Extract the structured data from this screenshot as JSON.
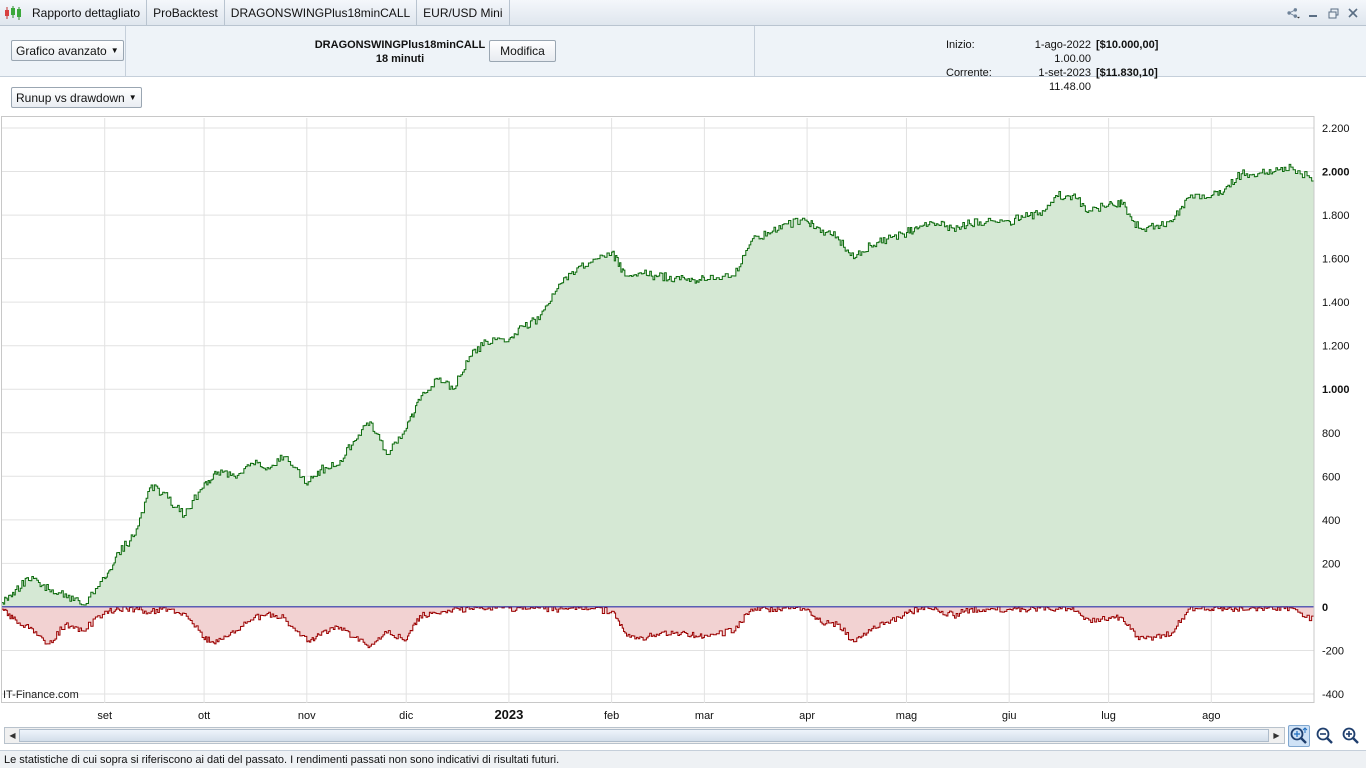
{
  "tabs": [
    "Rapporto dettagliato",
    "ProBacktest",
    "DRAGONSWINGPlus18minCALL",
    "EUR/USD Mini"
  ],
  "header": {
    "chart_mode": "Grafico avanzato",
    "strategy_name": "DRAGONSWINGPlus18minCALL",
    "timeframe": "18 minuti",
    "edit_button": "Modifica",
    "start_label": "Inizio:",
    "start_date": "1-ago-2022 1.00.00",
    "start_amount": "[$10.000,00]",
    "current_label": "Corrente:",
    "current_date": "1-set-2023 11.48.00",
    "current_amount": "[$11.830,10]"
  },
  "chart_selector": "Runup vs drawdown",
  "brand": "IT-Finance.com",
  "status_text": "Le statistiche di cui sopra si riferiscono ai dati del passato. I rendimenti passati non sono indicativi di risultati futuri.",
  "colors": {
    "runup_line": "#0b6a0b",
    "runup_fill": "#d5e8d4",
    "drawdown_line": "#9b0000",
    "drawdown_fill": "#f2d2d2",
    "zero_line": "#2a2aa8"
  },
  "chart_data": {
    "type": "area",
    "ylim": [
      -400,
      2200
    ],
    "y_ticks": [
      "2.200",
      "2.000",
      "1.800",
      "1.600",
      "1.400",
      "1.200",
      "1.000",
      "800",
      "600",
      "400",
      "200",
      "0",
      "-200",
      "-400"
    ],
    "y_tick_values": [
      2200,
      2000,
      1800,
      1600,
      1400,
      1200,
      1000,
      800,
      600,
      400,
      200,
      0,
      -200,
      -400
    ],
    "x_ticks": [
      "set",
      "ott",
      "nov",
      "dic",
      "2023",
      "feb",
      "mar",
      "apr",
      "mag",
      "giu",
      "lug",
      "ago"
    ],
    "x_tick_dates": [
      "2022-09-01",
      "2022-10-01",
      "2022-11-01",
      "2022-12-01",
      "2023-01-01",
      "2023-02-01",
      "2023-03-01",
      "2023-04-01",
      "2023-05-01",
      "2023-06-01",
      "2023-07-01",
      "2023-08-01"
    ],
    "series": [
      {
        "name": "Runup",
        "x": [
          "2022-08-01",
          "2022-08-05",
          "2022-08-10",
          "2022-08-15",
          "2022-08-20",
          "2022-08-25",
          "2022-09-01",
          "2022-09-05",
          "2022-09-10",
          "2022-09-15",
          "2022-09-20",
          "2022-09-25",
          "2022-10-01",
          "2022-10-05",
          "2022-10-10",
          "2022-10-15",
          "2022-10-20",
          "2022-10-25",
          "2022-11-01",
          "2022-11-05",
          "2022-11-10",
          "2022-11-15",
          "2022-11-20",
          "2022-11-25",
          "2022-12-01",
          "2022-12-05",
          "2022-12-10",
          "2022-12-15",
          "2022-12-20",
          "2022-12-25",
          "2023-01-01",
          "2023-01-05",
          "2023-01-10",
          "2023-01-15",
          "2023-01-20",
          "2023-01-25",
          "2023-02-01",
          "2023-02-05",
          "2023-02-10",
          "2023-02-15",
          "2023-02-20",
          "2023-02-25",
          "2023-03-01",
          "2023-03-10",
          "2023-03-15",
          "2023-03-20",
          "2023-03-25",
          "2023-04-01",
          "2023-04-05",
          "2023-04-10",
          "2023-04-15",
          "2023-04-20",
          "2023-04-25",
          "2023-05-01",
          "2023-05-05",
          "2023-05-10",
          "2023-05-15",
          "2023-05-20",
          "2023-05-25",
          "2023-06-01",
          "2023-06-05",
          "2023-06-10",
          "2023-06-15",
          "2023-06-20",
          "2023-06-25",
          "2023-07-01",
          "2023-07-05",
          "2023-07-10",
          "2023-07-15",
          "2023-07-20",
          "2023-07-25",
          "2023-08-01",
          "2023-08-05",
          "2023-08-10",
          "2023-08-15",
          "2023-08-20",
          "2023-08-25",
          "2023-09-01"
        ],
        "y": [
          20,
          80,
          140,
          80,
          60,
          10,
          130,
          250,
          330,
          560,
          500,
          420,
          570,
          620,
          600,
          660,
          640,
          690,
          560,
          630,
          650,
          760,
          850,
          700,
          820,
          950,
          1050,
          1000,
          1150,
          1220,
          1230,
          1290,
          1320,
          1450,
          1540,
          1580,
          1630,
          1520,
          1530,
          1520,
          1510,
          1510,
          1500,
          1520,
          1680,
          1720,
          1760,
          1770,
          1720,
          1700,
          1600,
          1660,
          1690,
          1720,
          1750,
          1760,
          1740,
          1760,
          1770,
          1770,
          1790,
          1810,
          1890,
          1890,
          1820,
          1850,
          1850,
          1740,
          1750,
          1770,
          1880,
          1890,
          1920,
          1990,
          1990,
          2000,
          2020,
          1960
        ]
      },
      {
        "name": "Drawdown",
        "x": [
          "2022-08-01",
          "2022-08-05",
          "2022-08-10",
          "2022-08-15",
          "2022-08-20",
          "2022-08-25",
          "2022-09-01",
          "2022-09-05",
          "2022-09-10",
          "2022-09-15",
          "2022-09-20",
          "2022-09-25",
          "2022-10-01",
          "2022-10-05",
          "2022-10-10",
          "2022-10-15",
          "2022-10-20",
          "2022-10-25",
          "2022-11-01",
          "2022-11-05",
          "2022-11-10",
          "2022-11-15",
          "2022-11-20",
          "2022-11-25",
          "2022-12-01",
          "2022-12-05",
          "2022-12-10",
          "2022-12-15",
          "2022-12-20",
          "2022-12-25",
          "2023-01-01",
          "2023-01-05",
          "2023-01-10",
          "2023-01-15",
          "2023-01-20",
          "2023-01-25",
          "2023-02-01",
          "2023-02-05",
          "2023-02-10",
          "2023-02-15",
          "2023-02-20",
          "2023-02-25",
          "2023-03-01",
          "2023-03-10",
          "2023-03-15",
          "2023-03-20",
          "2023-03-25",
          "2023-04-01",
          "2023-04-05",
          "2023-04-10",
          "2023-04-15",
          "2023-04-20",
          "2023-04-25",
          "2023-05-01",
          "2023-05-05",
          "2023-05-10",
          "2023-05-15",
          "2023-05-20",
          "2023-05-25",
          "2023-06-01",
          "2023-06-05",
          "2023-06-10",
          "2023-06-15",
          "2023-06-20",
          "2023-06-25",
          "2023-07-01",
          "2023-07-05",
          "2023-07-10",
          "2023-07-15",
          "2023-07-20",
          "2023-07-25",
          "2023-08-01",
          "2023-08-05",
          "2023-08-10",
          "2023-08-15",
          "2023-08-20",
          "2023-08-25",
          "2023-09-01"
        ],
        "y": [
          -10,
          -60,
          -100,
          -170,
          -80,
          -110,
          -20,
          -10,
          -10,
          -20,
          -10,
          -30,
          -150,
          -160,
          -120,
          -60,
          -30,
          -50,
          -160,
          -130,
          -90,
          -140,
          -180,
          -120,
          -150,
          -40,
          -30,
          -10,
          -10,
          -10,
          -5,
          -10,
          -5,
          -10,
          -5,
          -10,
          -20,
          -120,
          -140,
          -130,
          -120,
          -130,
          -130,
          -110,
          -10,
          -10,
          -5,
          -10,
          -70,
          -80,
          -160,
          -110,
          -70,
          -30,
          -10,
          -10,
          -40,
          -10,
          -10,
          -10,
          -10,
          -5,
          -10,
          -5,
          -60,
          -50,
          -50,
          -150,
          -140,
          -120,
          -10,
          -10,
          -10,
          -5,
          -5,
          -10,
          -5,
          -60
        ]
      }
    ],
    "grid": true,
    "legend": "none"
  }
}
